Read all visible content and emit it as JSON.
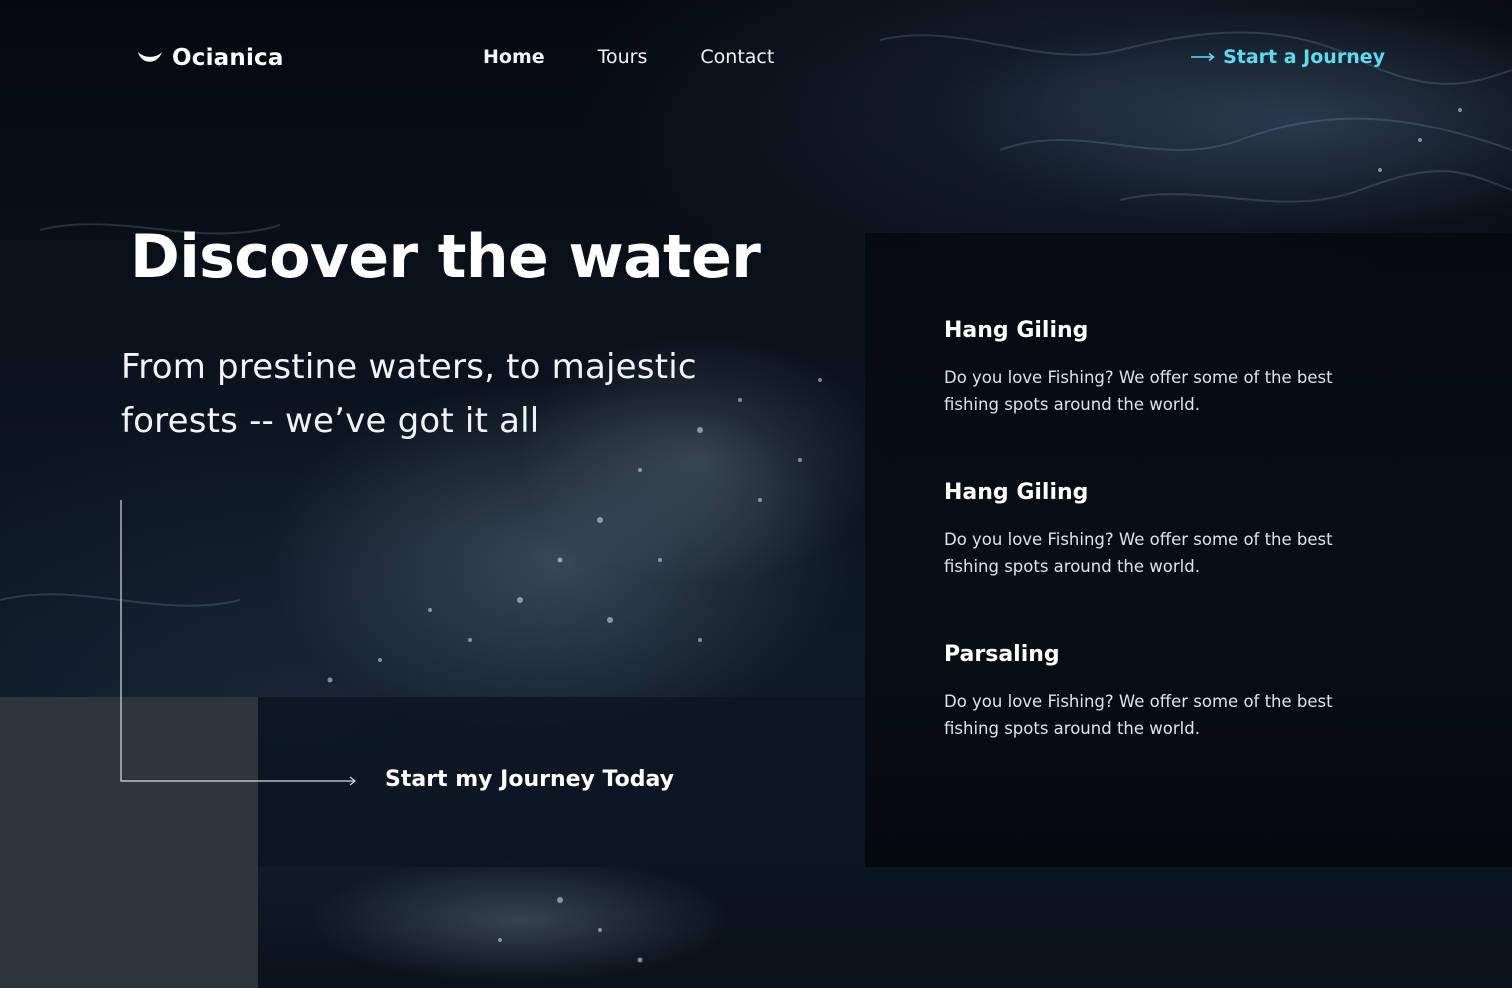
{
  "brand": {
    "name": "Ocianica",
    "icon": "wave-icon"
  },
  "nav": {
    "items": [
      {
        "label": "Home",
        "active": true
      },
      {
        "label": "Tours",
        "active": false
      },
      {
        "label": "Contact",
        "active": false
      }
    ]
  },
  "header_cta": {
    "label": "Start a Journey",
    "icon": "arrow-right-icon"
  },
  "hero": {
    "title": "Discover the water",
    "subtitle": "From prestine waters, to majestic forests -- we’ve got it all"
  },
  "journey_cta": {
    "label": "Start my Journey Today"
  },
  "features": [
    {
      "title": "Hang Giling",
      "description": "Do you love Fishing? We offer some of the best fishing spots around the world."
    },
    {
      "title": "Hang Giling",
      "description": "Do you love Fishing? We offer some of the best fishing spots around the world."
    },
    {
      "title": "Parsaling",
      "description": "Do you love Fishing? We offer some of the best fishing spots around the world."
    }
  ],
  "colors": {
    "accent": "#5ddcf0",
    "background": "#04080d",
    "panel_gray": "#2e343c",
    "text": "#ffffff"
  }
}
